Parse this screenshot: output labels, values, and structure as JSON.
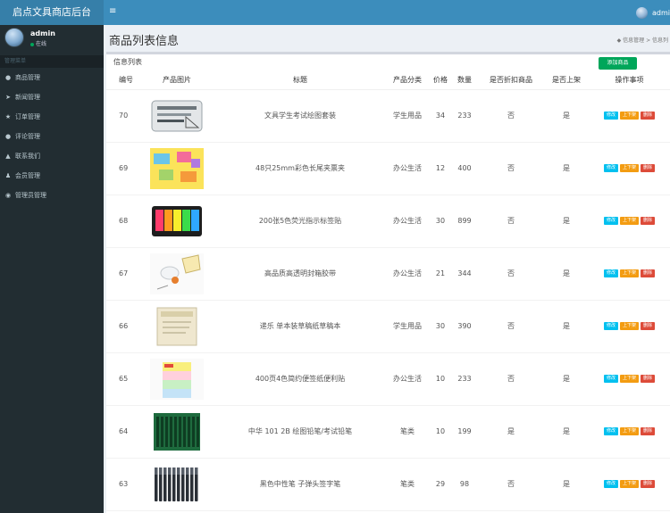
{
  "brand": {
    "title": "启点文具商店后台"
  },
  "user": {
    "name": "admin",
    "status": "在线"
  },
  "sidebar": {
    "header": "管理菜单",
    "items": [
      {
        "label": "商品管理",
        "icon": "tag-icon"
      },
      {
        "label": "新闻管理",
        "icon": "paper-plane-icon"
      },
      {
        "label": "订单管理",
        "icon": "star-icon"
      },
      {
        "label": "评论管理",
        "icon": "comment-icon"
      },
      {
        "label": "联系我们",
        "icon": "chart-icon"
      },
      {
        "label": "会员管理",
        "icon": "users-icon"
      },
      {
        "label": "管理员管理",
        "icon": "user-circle-icon"
      }
    ]
  },
  "topbar": {
    "toggle": "≡",
    "user": "admi"
  },
  "page": {
    "title": "商品列表信息",
    "breadcrumb": "信息管理 > 信息列"
  },
  "box": {
    "title": "信息列表",
    "add_label": "添加商品"
  },
  "table": {
    "headers": [
      "编号",
      "产品图片",
      "标题",
      "产品分类",
      "价格",
      "数量",
      "是否折扣商品",
      "是否上架",
      "操作事项"
    ],
    "ops": {
      "edit": "修改",
      "shelf": "上下架",
      "delete": "删除"
    },
    "rows": [
      {
        "id": "70",
        "title": "文具学生考试绘图套装",
        "category": "学生用品",
        "price": "34",
        "qty": "233",
        "discount": "否",
        "onsale": "是",
        "img": "drawing-set"
      },
      {
        "id": "69",
        "title": "48只25mm彩色长尾夹票夹",
        "category": "办公生活",
        "price": "12",
        "qty": "400",
        "discount": "否",
        "onsale": "是",
        "img": "binder-clips"
      },
      {
        "id": "68",
        "title": "200张5色荧光指示标签贴",
        "category": "办公生活",
        "price": "30",
        "qty": "899",
        "discount": "否",
        "onsale": "是",
        "img": "sticky-tabs"
      },
      {
        "id": "67",
        "title": "高品质高透明封箱胶带",
        "category": "办公生活",
        "price": "21",
        "qty": "344",
        "discount": "否",
        "onsale": "是",
        "img": "tape"
      },
      {
        "id": "66",
        "title": "递乐 单本装草稿纸草稿本",
        "category": "学生用品",
        "price": "30",
        "qty": "390",
        "discount": "否",
        "onsale": "是",
        "img": "draft-paper"
      },
      {
        "id": "65",
        "title": "400页4色简约便签纸便利贴",
        "category": "办公生活",
        "price": "10",
        "qty": "233",
        "discount": "否",
        "onsale": "是",
        "img": "sticky-notes"
      },
      {
        "id": "64",
        "title": "中华 101 2B 绘图铅笔/考试铅笔",
        "category": "笔类",
        "price": "10",
        "qty": "199",
        "discount": "是",
        "onsale": "是",
        "img": "pencils"
      },
      {
        "id": "63",
        "title": "黑色中性笔 子弹头签字笔",
        "category": "笔类",
        "price": "29",
        "qty": "98",
        "discount": "否",
        "onsale": "是",
        "img": "gel-pens"
      }
    ]
  },
  "colors": {
    "topbar": "#3c8dbc",
    "sidebar": "#222d32",
    "add": "#00a65a",
    "edit": "#00c0ef",
    "shelf": "#f39c12",
    "delete": "#dd4b39"
  }
}
